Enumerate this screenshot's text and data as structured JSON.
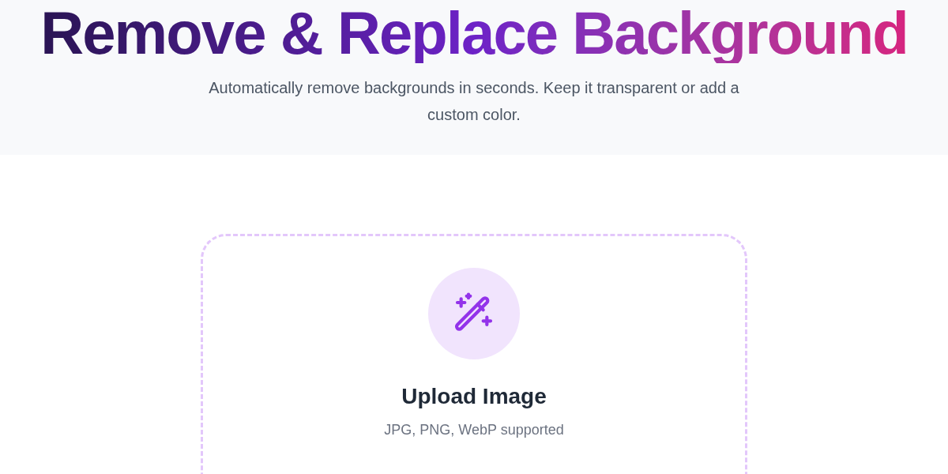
{
  "hero": {
    "title": "Remove & Replace Background",
    "subtitle": "Automatically remove backgrounds in seconds. Keep it transparent or add a custom color."
  },
  "upload": {
    "title": "Upload Image",
    "hint": "JPG, PNG, WebP supported"
  }
}
